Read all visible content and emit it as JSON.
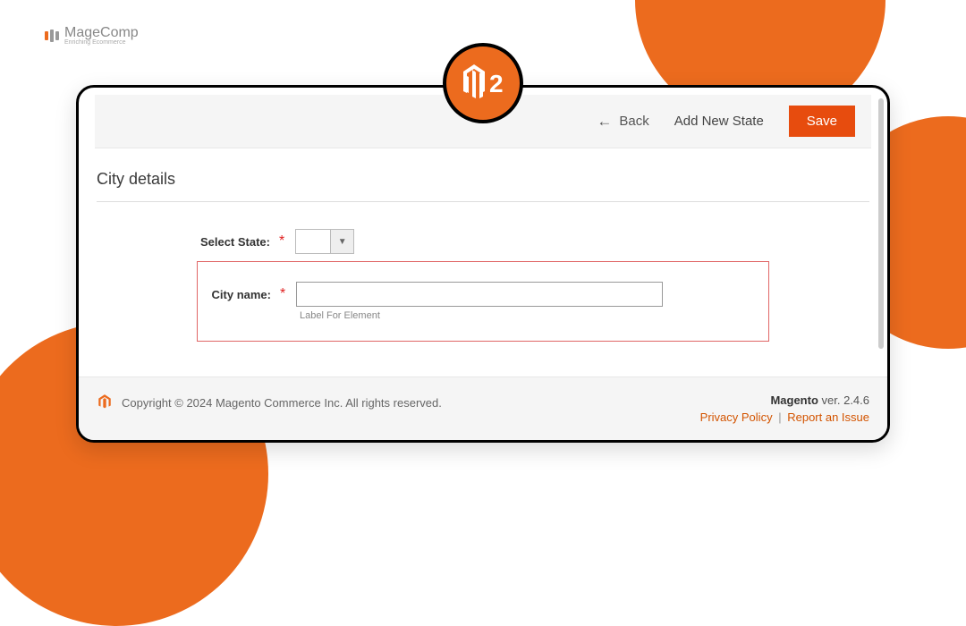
{
  "logo": {
    "name": "MageComp",
    "tagline": "Enriching Ecommerce"
  },
  "badge": {
    "text": "2"
  },
  "toolbar": {
    "back_label": "Back",
    "add_state_label": "Add New State",
    "save_label": "Save"
  },
  "section": {
    "title": "City details"
  },
  "form": {
    "select_state": {
      "label": "Select State:",
      "value": ""
    },
    "city_name": {
      "label": "City name:",
      "value": "",
      "helper": "Label For Element"
    }
  },
  "footer": {
    "copyright": "Copyright © 2024 Magento Commerce Inc. All rights reserved.",
    "brand": "Magento",
    "version": " ver. 2.4.6",
    "privacy": "Privacy Policy",
    "report": "Report an Issue"
  }
}
